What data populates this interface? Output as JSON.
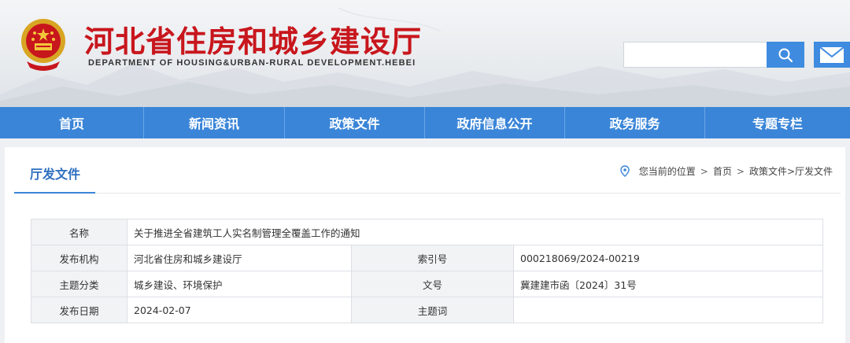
{
  "header": {
    "title": "河北省住房和城乡建设厅",
    "subtitle": "DEPARTMENT OF HOUSING&URBAN-RURAL DEVELOPMENT.HEBEI",
    "emblem_icon": "national-emblem-icon",
    "search": {
      "placeholder": "",
      "button_icon": "search-icon"
    },
    "mail_icon": "mail-icon",
    "title_color": "#c8161d"
  },
  "nav": {
    "items": [
      {
        "label": "首页"
      },
      {
        "label": "新闻资讯"
      },
      {
        "label": "政策文件"
      },
      {
        "label": "政府信息公开"
      },
      {
        "label": "政务服务"
      },
      {
        "label": "专题专栏"
      }
    ],
    "color": "#3a85d8"
  },
  "section": {
    "title": "厅发文件",
    "breadcrumb": {
      "icon": "location-pin-icon",
      "prefix": "您当前的位置",
      "home": "首页",
      "trail": "政策文件>厅发文件"
    }
  },
  "meta": {
    "name_label": "名称",
    "name_value": "关于推进全省建筑工人实名制管理全覆盖工作的通知",
    "rows": [
      {
        "k1": "发布机构",
        "v1": "河北省住房和城乡建设厅",
        "k2": "索引号",
        "v2": "000218069/2024-00219"
      },
      {
        "k1": "主题分类",
        "v1": "城乡建设、环境保护",
        "k2": "文号",
        "v2": "冀建建市函〔2024〕31号"
      },
      {
        "k1": "发布日期",
        "v1": "2024-02-07",
        "k2": "主题词",
        "v2": ""
      }
    ]
  }
}
